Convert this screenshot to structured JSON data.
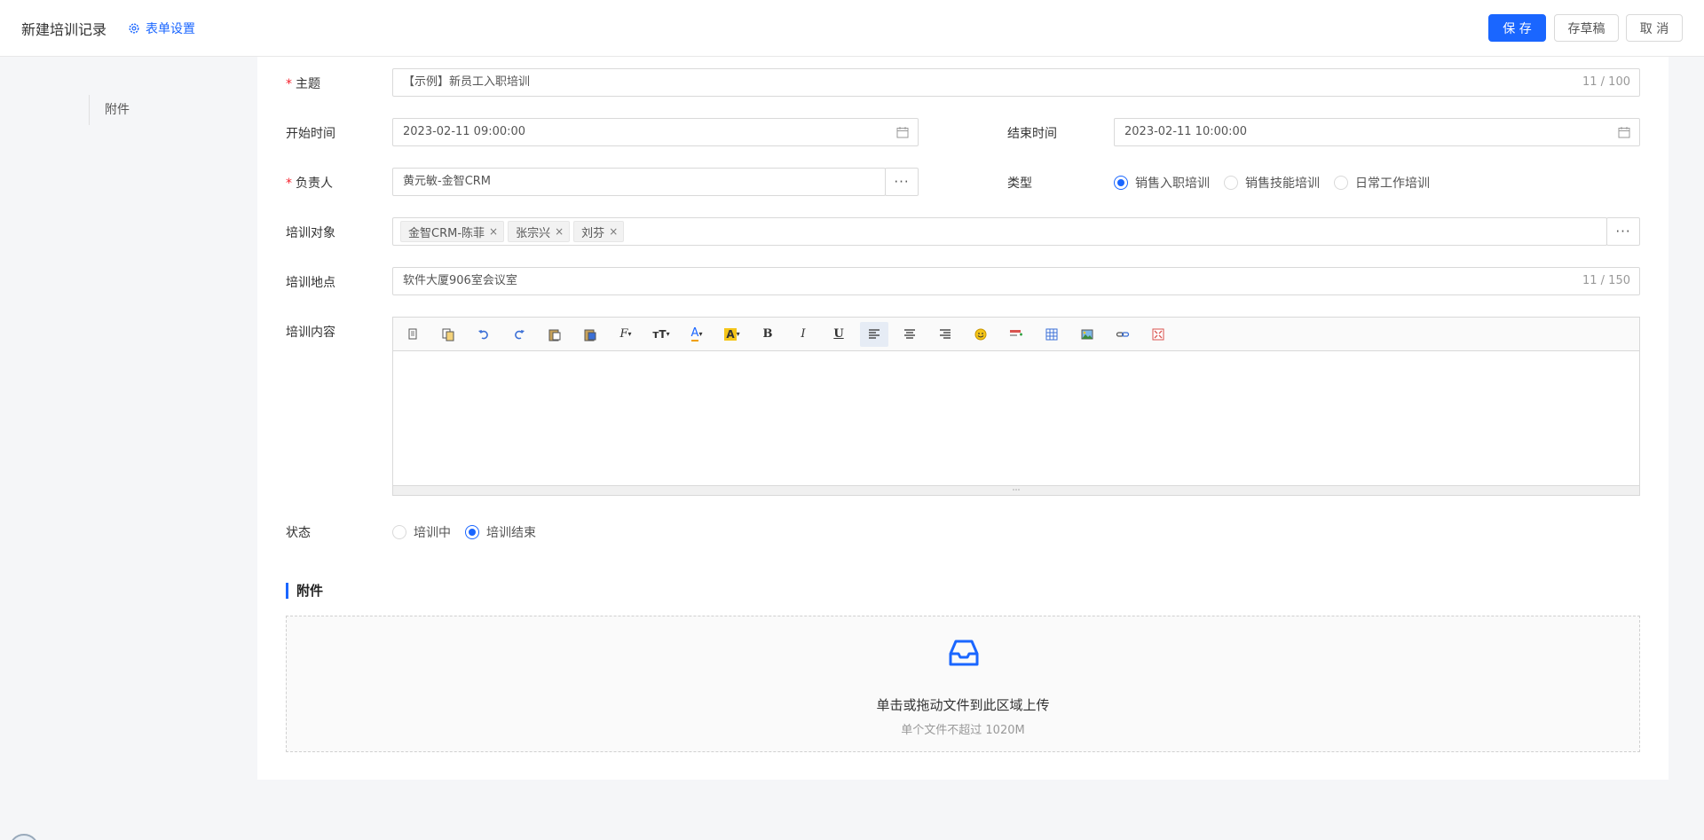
{
  "header": {
    "title": "新建培训记录",
    "form_settings": "表单设置",
    "save": "保 存",
    "draft": "存草稿",
    "cancel": "取 消"
  },
  "anchor": {
    "label": "附件"
  },
  "fields": {
    "subject": {
      "label": "主题",
      "value": "【示例】新员工入职培训",
      "counter": "11 / 100"
    },
    "start_time": {
      "label": "开始时间",
      "value": "2023-02-11 09:00:00"
    },
    "end_time": {
      "label": "结束时间",
      "value": "2023-02-11 10:00:00"
    },
    "owner": {
      "label": "负责人",
      "value": "黄元敏-金智CRM"
    },
    "type": {
      "label": "类型",
      "options": [
        "销售入职培训",
        "销售技能培训",
        "日常工作培训"
      ],
      "selected": "销售入职培训"
    },
    "trainees": {
      "label": "培训对象",
      "tags": [
        "金智CRM-陈菲",
        "张宗兴",
        "刘芬"
      ]
    },
    "location": {
      "label": "培训地点",
      "value": "软件大厦906室会议室",
      "counter": "11 / 150"
    },
    "content": {
      "label": "培训内容"
    },
    "status": {
      "label": "状态",
      "options": [
        "培训中",
        "培训结束"
      ],
      "selected": "培训结束"
    }
  },
  "toolbar": {
    "buttons": [
      "cut-icon",
      "copy-icon",
      "undo-icon",
      "redo-icon",
      "paste-icon",
      "paste-word-icon",
      "font-family-icon",
      "font-size-icon",
      "font-color-icon",
      "highlight-icon",
      "bold-icon",
      "italic-icon",
      "underline-icon",
      "align-left-icon",
      "align-center-icon",
      "align-right-icon",
      "emoji-icon",
      "insert-row-icon",
      "table-icon",
      "image-icon",
      "link-icon",
      "fullscreen-icon"
    ],
    "text": {
      "bold": "B",
      "italic": "I",
      "underline": "U",
      "font_family": "F",
      "font_size": "тT",
      "font_color": "A",
      "highlight": "A",
      "resize": "⋯"
    }
  },
  "attachments": {
    "title": "附件",
    "upload_main": "单击或拖动文件到此区域上传",
    "upload_sub": "单个文件不超过 1020M"
  },
  "colors": {
    "primary": "#1a66ff",
    "required": "#f5222d"
  }
}
